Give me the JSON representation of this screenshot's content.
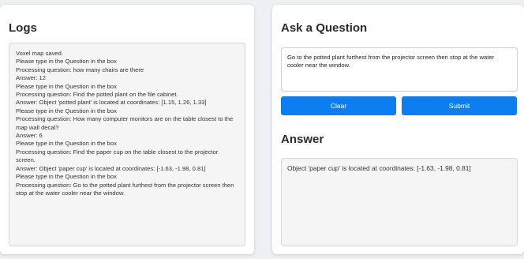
{
  "logs": {
    "title": "Logs",
    "lines": [
      "Voxel map saved.",
      "Please type in the Question in the box",
      "Processing question: how many chairs are there",
      "Answer: 12",
      "Please type in the Question in the box",
      "Processing question: Find the potted plant on the file cabinet.",
      "Answer: Object 'potted plant' is located at coordinates: [1.15, 1.26, 1.33]",
      "Please type in the Question in the box",
      "Processing question: How many computer monitors are on the table closest to the map wall decal?",
      "Answer: 6",
      "Please type in the Question in the box",
      "Processing question: Find the paper cup on the table closest to the projector screen.",
      "Answer: Object 'paper cup' is located at coordinates: [-1.63, -1.98, 0.81]",
      "Please type in the Question in the box",
      "Processing question: Go to the potted plant furthest from the projector screen then stop at the water cooler near the window."
    ]
  },
  "ask": {
    "title": "Ask a Question",
    "question_value": "Go to the potted plant furthest from the projector screen then stop at the water cooler near the window.",
    "clear_label": "Clear",
    "submit_label": "Submit"
  },
  "answer": {
    "title": "Answer",
    "text": "Object 'paper cup' is located at coordinates: [-1.63, -1.98, 0.81]"
  },
  "colors": {
    "button_blue": "#0d7ef0",
    "panel_bg": "#ffffff",
    "page_bg": "#eef0f3"
  }
}
